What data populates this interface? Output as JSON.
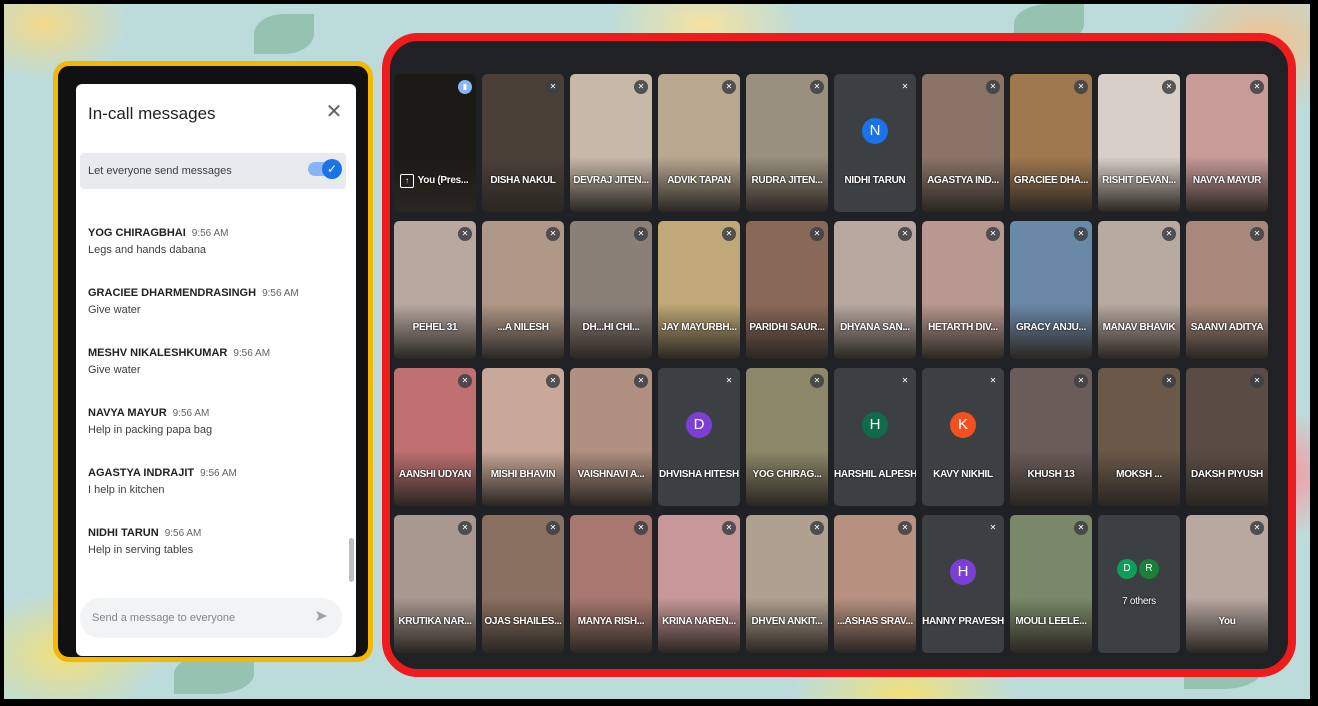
{
  "chat": {
    "title": "In-call messages",
    "toggle_label": "Let everyone send messages",
    "send_placeholder": "Send a message to everyone",
    "messages": [
      {
        "sender": "YOG CHIRAGBHAI",
        "time": "9:56 AM",
        "text": "Legs and hands dabana"
      },
      {
        "sender": "GRACIEE DHARMENDRASINGH",
        "time": "9:56 AM",
        "text": "Give water"
      },
      {
        "sender": "MESHV NIKALESHKUMAR",
        "time": "9:56 AM",
        "text": "Give water"
      },
      {
        "sender": "NAVYA MAYUR",
        "time": "9:56 AM",
        "text": "Help in packing papa bag"
      },
      {
        "sender": "AGASTYA INDRAJIT",
        "time": "9:56 AM",
        "text": "I help in kitchen"
      },
      {
        "sender": "NIDHI TARUN",
        "time": "9:56 AM",
        "text": "Help  in serving tables"
      }
    ]
  },
  "grid": {
    "tiles": [
      {
        "name": "You (Pres...",
        "bg": "#1c1a14",
        "mic": "active",
        "present": true
      },
      {
        "name": "DISHA NAKUL",
        "bg": "#4a4038"
      },
      {
        "name": "DEVRAJ JITEN...",
        "bg": "#c8b8a8"
      },
      {
        "name": "ADVIK TAPAN",
        "bg": "#b8a890"
      },
      {
        "name": "RUDRA JITEN...",
        "bg": "#9a9080"
      },
      {
        "name": "NIDHI TARUN",
        "avatar": "N",
        "avatar_color": "#1a73e8"
      },
      {
        "name": "AGASTYA IND...",
        "bg": "#8a7468"
      },
      {
        "name": "GRACIEE DHA...",
        "bg": "#a07850"
      },
      {
        "name": "RISHIT DEVAN...",
        "bg": "#d8d0c8"
      },
      {
        "name": "NAVYA MAYUR",
        "bg": "#c89a98"
      },
      {
        "name": "PEHEL 31",
        "bg": "#b8a8a0"
      },
      {
        "name": "...A NILESH",
        "bg": "#b09888"
      },
      {
        "name": "DH...HI CHI...",
        "bg": "#8a8078"
      },
      {
        "name": "JAY MAYURBH...",
        "bg": "#c0a878"
      },
      {
        "name": "PARIDHI SAUR...",
        "bg": "#8a6858"
      },
      {
        "name": "DHYANA SAN...",
        "bg": "#b8a8a0"
      },
      {
        "name": "HETARTH DIV...",
        "bg": "#b89890"
      },
      {
        "name": "GRACY ANJU...",
        "bg": "#6a88a8"
      },
      {
        "name": "MANAV BHAVIK",
        "bg": "#b8aaa0"
      },
      {
        "name": "SAANVI ADITYA",
        "bg": "#a8887a"
      },
      {
        "name": "AANSHI UDYAN",
        "bg": "#c07070"
      },
      {
        "name": "MISHI BHAVIN",
        "bg": "#c8a898"
      },
      {
        "name": "VAISHNAVI A...",
        "bg": "#b09080"
      },
      {
        "name": "DHVISHA HITESH",
        "avatar": "D",
        "avatar_color": "#7b3fd4"
      },
      {
        "name": "YOG CHIRAG...",
        "bg": "#8a8868"
      },
      {
        "name": "HARSHIL ALPESH",
        "avatar": "H",
        "avatar_color": "#0f6b4a"
      },
      {
        "name": "KAVY NIKHIL",
        "avatar": "K",
        "avatar_color": "#f4511e"
      },
      {
        "name": "KHUSH 13",
        "bg": "#6a5c58"
      },
      {
        "name": "MOKSH ...",
        "bg": "#6a5848"
      },
      {
        "name": "DAKSH PIYUSH",
        "bg": "#5a4c44"
      },
      {
        "name": "KRUTIKA NAR...",
        "bg": "#a89890"
      },
      {
        "name": "OJAS SHAILES...",
        "bg": "#8a7060"
      },
      {
        "name": "MANYA RISH...",
        "bg": "#a87870"
      },
      {
        "name": "KRINA NAREN...",
        "bg": "#c89898"
      },
      {
        "name": "DHVEN ANKIT...",
        "bg": "#b0a090"
      },
      {
        "name": "...ASHAS SRAV...",
        "bg": "#b89080"
      },
      {
        "name": "HANNY PRAVESH",
        "avatar": "H",
        "avatar_color": "#7b3fd4"
      },
      {
        "name": "MOULI LEELE...",
        "bg": "#788868"
      },
      {
        "name": "7 others",
        "others": true
      },
      {
        "name": "You",
        "bg": "#b8a8a0"
      }
    ],
    "others_initials": [
      {
        "letter": "D",
        "color": "#0f9d58"
      },
      {
        "letter": "R",
        "color": "#188038"
      }
    ]
  }
}
